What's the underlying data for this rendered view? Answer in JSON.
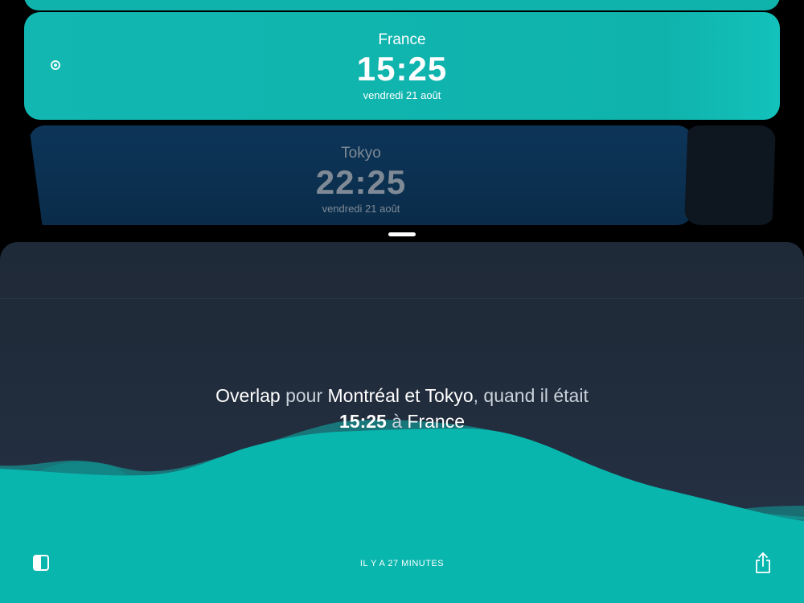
{
  "cards": [
    {
      "city": "France",
      "time": "15:25",
      "date": "vendredi 21 août"
    },
    {
      "city": "Tokyo",
      "time": "22:25",
      "date": "vendredi 21 août"
    }
  ],
  "overlap": {
    "word_overlap": "Overlap",
    "word_pour": " pour ",
    "cities": "Montréal et Tokyo",
    "word_quand": ", quand il était ",
    "time": "15:25",
    "word_a": " à ",
    "place": "France"
  },
  "footer": {
    "status": "IL Y A 27 MINUTES"
  },
  "colors": {
    "accent": "#10b2ac",
    "panel": "#1f2a38",
    "tokyo_card": "#0d3558"
  },
  "icons": {
    "left_toggle": "split-square-icon",
    "share": "share-icon",
    "selector": "radio-dot-icon"
  }
}
